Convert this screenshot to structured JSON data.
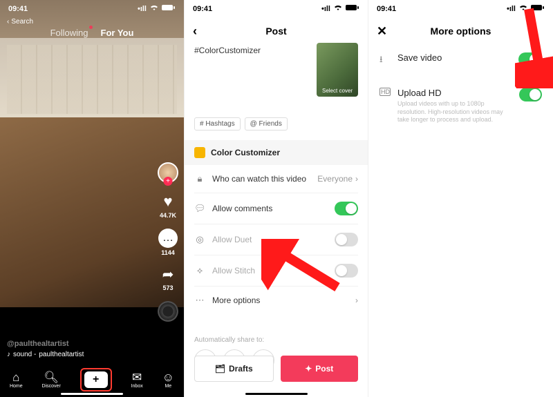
{
  "feed": {
    "time": "09:41",
    "search_label": "Search",
    "tabs": {
      "following": "Following",
      "foryou": "For You"
    },
    "likes": "44.7K",
    "comments": "1144",
    "shares": "573",
    "username": "@paulthealtartist",
    "sound_prefix": "sound - ",
    "sound": "paulthealtartist",
    "nav": {
      "home": "Home",
      "discover": "Discover",
      "inbox": "Inbox",
      "me": "Me"
    }
  },
  "post": {
    "time": "09:41",
    "title": "Post",
    "caption": "#ColorCustomizer",
    "cover_label": "Select cover",
    "pills": {
      "hashtags": "# Hashtags",
      "friends": "@ Friends"
    },
    "app_name": "Color Customizer",
    "rows": {
      "privacy": "Who can watch this video",
      "privacy_value": "Everyone",
      "comments": "Allow comments",
      "duet": "Allow Duet",
      "stitch": "Allow Stitch",
      "more": "More options"
    },
    "share_label": "Automatically share to:",
    "drafts_btn": "Drafts",
    "post_btn": "Post"
  },
  "more": {
    "time": "09:41",
    "title": "More options",
    "save": "Save video",
    "hd_title": "Upload HD",
    "hd_desc": "Upload videos with up to 1080p resolution. High-resolution videos may take longer to process and upload."
  }
}
